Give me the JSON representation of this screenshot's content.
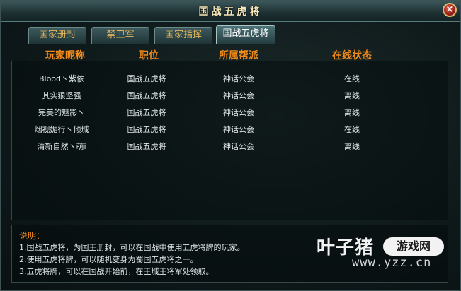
{
  "window": {
    "title": "国战五虎将",
    "close_label": "×"
  },
  "tabs": [
    {
      "label": "国家册封",
      "active": false
    },
    {
      "label": "禁卫军",
      "active": false
    },
    {
      "label": "国家指挥",
      "active": false
    },
    {
      "label": "国战五虎将",
      "active": true
    }
  ],
  "table": {
    "headers": [
      "玩家昵称",
      "职位",
      "所属帮派",
      "在线状态"
    ],
    "rows": [
      [
        "Blood丶紫依",
        "国战五虎将",
        "神话公会",
        "在线"
      ],
      [
        "其实狠坚强",
        "国战五虎将",
        "神话公会",
        "离线"
      ],
      [
        "完美的魅影丶",
        "国战五虎将",
        "神话公会",
        "离线"
      ],
      [
        "烟视媚行丶倾城",
        "国战五虎将",
        "神话公会",
        "在线"
      ],
      [
        "清新自然丶萌i",
        "国战五虎将",
        "神话公会",
        "离线"
      ]
    ]
  },
  "notes": {
    "title": "说明：",
    "lines": [
      "1.国战五虎将，为国王册封，可以在国战中使用五虎将牌的玩家。",
      "2.使用五虎将牌，可以随机变身为蜀国五虎将之一。",
      "3.五虎将牌，可以在国战开始前，在王城王将军处领取。"
    ]
  },
  "watermark": {
    "brand": "叶子猪",
    "badge": "游戏网",
    "url": "www.yzz.cn"
  },
  "colors": {
    "header_orange": "#f08a1a",
    "tab_text": "#e0b45b",
    "text": "#dfe4e4"
  }
}
